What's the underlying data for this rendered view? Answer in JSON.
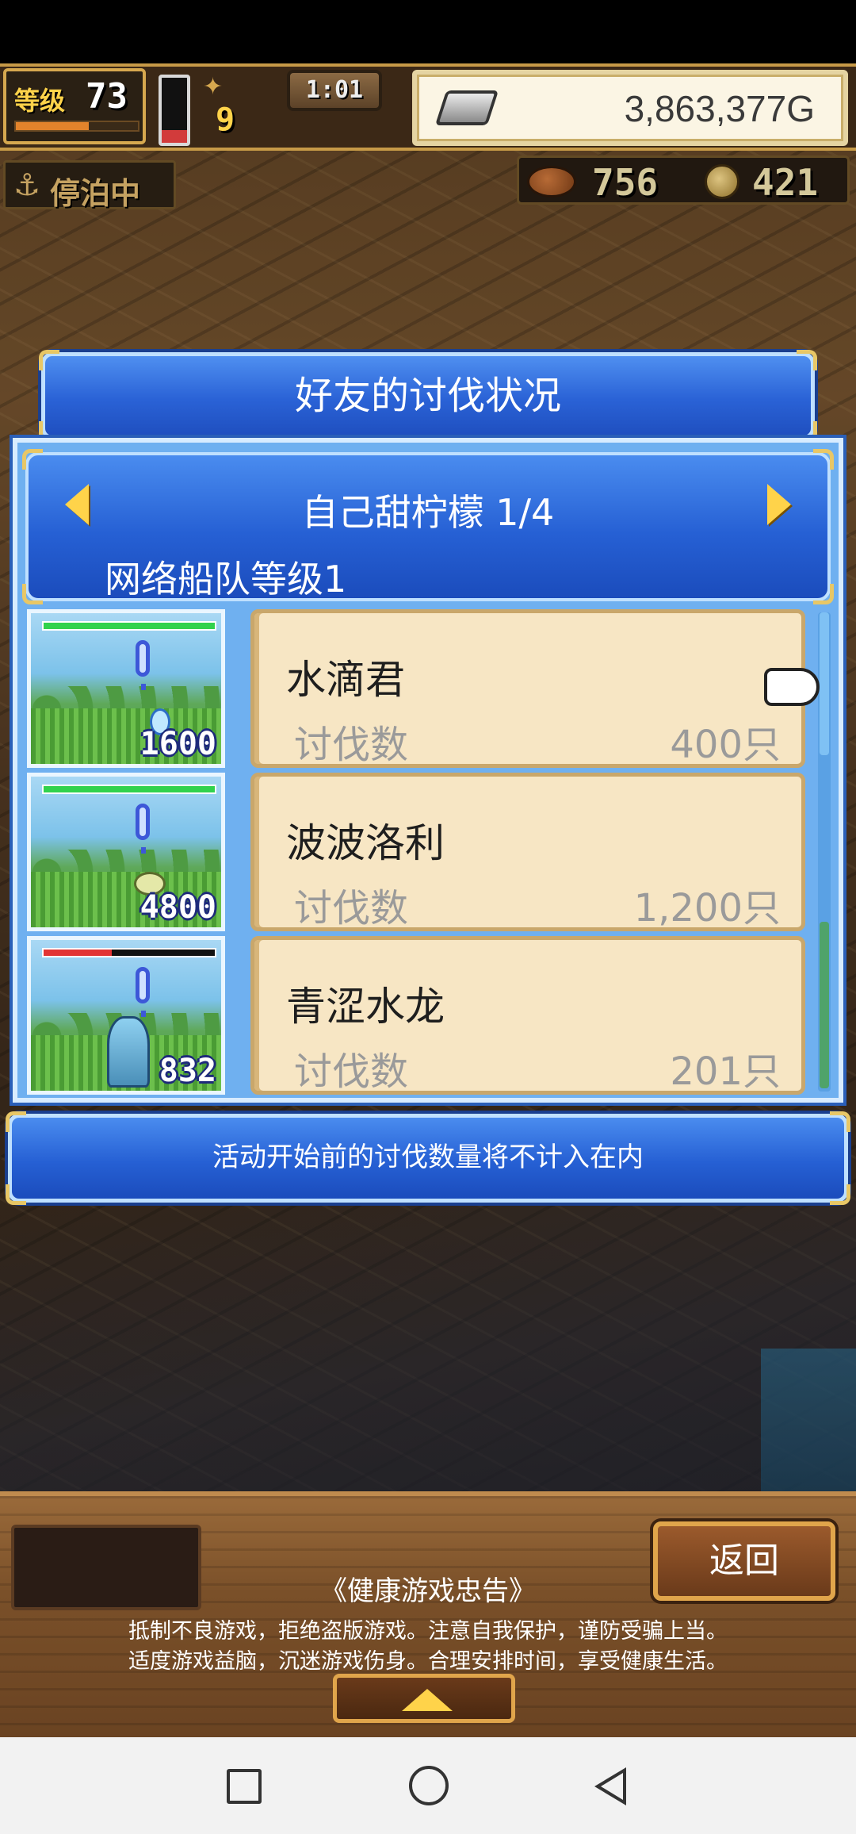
{
  "hud": {
    "level_label": "等级",
    "level_value": "73",
    "exp_fraction": 0.6,
    "stamina_fraction": 0.2,
    "fuel_value": "9",
    "clock": "1:01",
    "gold": "3,863,377G",
    "status": "停泊中",
    "meat": "756",
    "coins": "421"
  },
  "dialog": {
    "title": "好友的讨伐状况",
    "friend_name": "自己甜柠檬 1/4",
    "fleet_level": "网络船队等级1",
    "notice": "活动开始前的讨伐数量将不计入在内"
  },
  "monsters": [
    {
      "name": "水滴君",
      "stat_label": "讨伐数",
      "count": "400只",
      "thumb_number": "1600",
      "hp_fraction": 1.0,
      "hp_color": "#31d24d",
      "icon": "water-drop-icon"
    },
    {
      "name": "波波洛利",
      "stat_label": "讨伐数",
      "count": "1,200只",
      "thumb_number": "4800",
      "hp_fraction": 1.0,
      "hp_color": "#31d24d",
      "icon": "wave-creature-icon"
    },
    {
      "name": "青涩水龙",
      "stat_label": "讨伐数",
      "count": "201只",
      "thumb_number": "832",
      "hp_fraction": 0.4,
      "hp_color": "#e23434",
      "icon": "water-dragon-icon"
    }
  ],
  "bottom": {
    "back_label": "返回",
    "health_title": "《健康游戏忠告》",
    "health_line1": "抵制不良游戏，拒绝盗版游戏。注意自我保护，谨防受骗上当。",
    "health_line2": "适度游戏益脑，沉迷游戏伤身。合理安排时间，享受健康生活。"
  },
  "colors": {
    "accent_blue": "#2a62d6",
    "card_beige": "#f7e6c4",
    "gold_yellow": "#ffd34a"
  }
}
